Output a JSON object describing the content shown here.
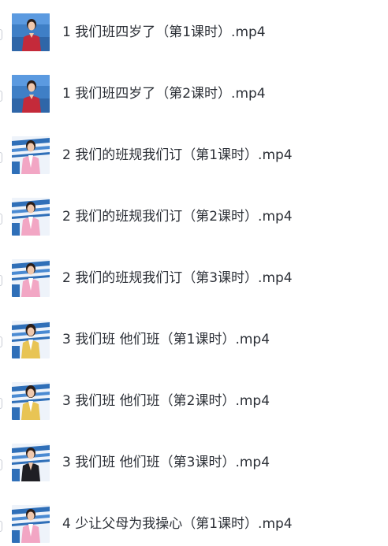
{
  "files": [
    {
      "name": "1 我们班四岁了（第1课时）.mp4",
      "thumb": "red-dress-blue-studio"
    },
    {
      "name": "1 我们班四岁了（第2课时）.mp4",
      "thumb": "red-dress-blue-studio"
    },
    {
      "name": "2 我们的班规我们订（第1课时）.mp4",
      "thumb": "pink-jacket-striped-studio"
    },
    {
      "name": "2 我们的班规我们订（第2课时）.mp4",
      "thumb": "pink-jacket-striped-studio"
    },
    {
      "name": "2 我们的班规我们订（第3课时）.mp4",
      "thumb": "pink-jacket-striped-studio"
    },
    {
      "name": "3 我们班 他们班（第1课时）.mp4",
      "thumb": "yellow-jacket-striped-studio"
    },
    {
      "name": "3 我们班 他们班（第2课时）.mp4",
      "thumb": "yellow-jacket-striped-studio"
    },
    {
      "name": "3 我们班 他们班（第3课时）.mp4",
      "thumb": "black-outfit-striped-studio"
    },
    {
      "name": "4 少让父母为我操心（第1课时）.mp4",
      "thumb": "pink-jacket-striped-studio"
    }
  ],
  "colors": {
    "text": "#2b2f36",
    "checkbox_border": "#c8ccd4",
    "studio_blue": "#2f6fb8",
    "red_dress": "#c42a3a",
    "pink_jacket": "#f2a6c4",
    "yellow_jacket": "#e8c454",
    "black_outfit": "#1f1f24"
  }
}
